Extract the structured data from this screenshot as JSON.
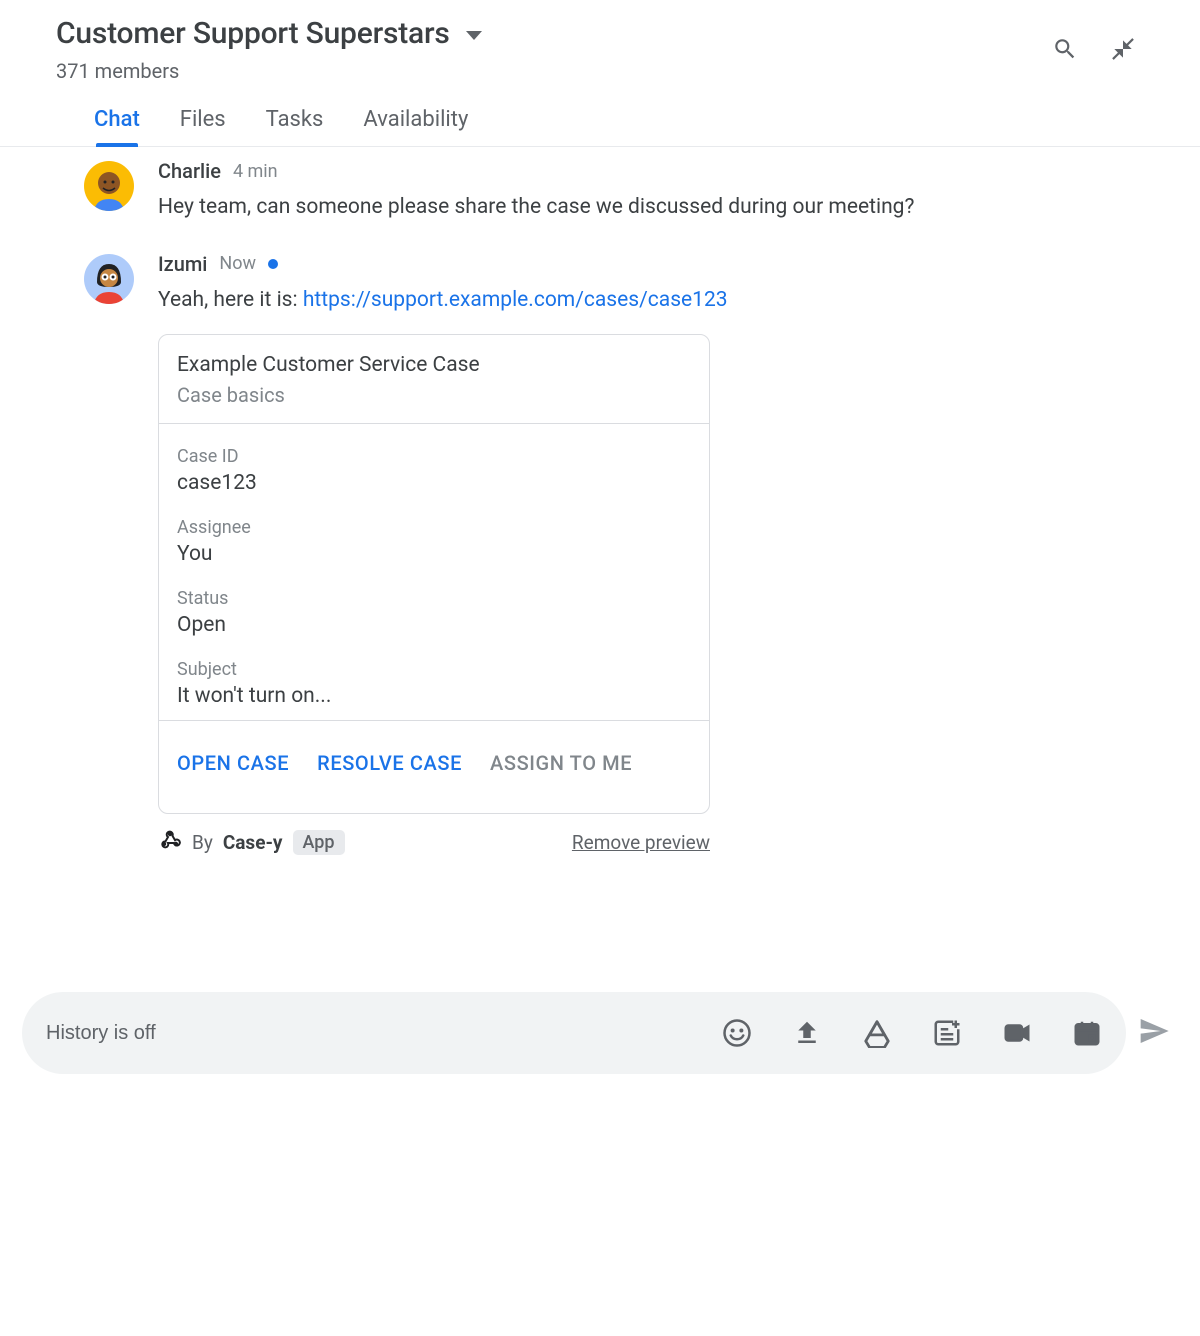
{
  "header": {
    "title": "Customer Support Superstars",
    "member_count": "371 members"
  },
  "tabs": [
    {
      "label": "Chat",
      "active": true
    },
    {
      "label": "Files",
      "active": false
    },
    {
      "label": "Tasks",
      "active": false
    },
    {
      "label": "Availability",
      "active": false
    }
  ],
  "messages": [
    {
      "author": "Charlie",
      "time": "4 min",
      "text": "Hey team, can someone please share the case we discussed during our meeting?"
    },
    {
      "author": "Izumi",
      "time": "Now",
      "now_indicator": true,
      "text_prefix": "Yeah, here it is: ",
      "link_text": "https://support.example.com/cases/case123",
      "card": {
        "title": "Example Customer Service Case",
        "subtitle": "Case basics",
        "fields": [
          {
            "label": "Case ID",
            "value": "case123"
          },
          {
            "label": "Assignee",
            "value": "You"
          },
          {
            "label": "Status",
            "value": "Open"
          },
          {
            "label": "Subject",
            "value": "It won't turn on..."
          }
        ],
        "actions": [
          {
            "label": "OPEN CASE",
            "disabled": false
          },
          {
            "label": "RESOLVE CASE",
            "disabled": false
          },
          {
            "label": "ASSIGN TO ME",
            "disabled": true
          }
        ],
        "by_label": "By",
        "by_app": "Case-y",
        "app_badge": "App",
        "remove_label": "Remove preview"
      }
    }
  ],
  "composer": {
    "placeholder": "History is off"
  }
}
